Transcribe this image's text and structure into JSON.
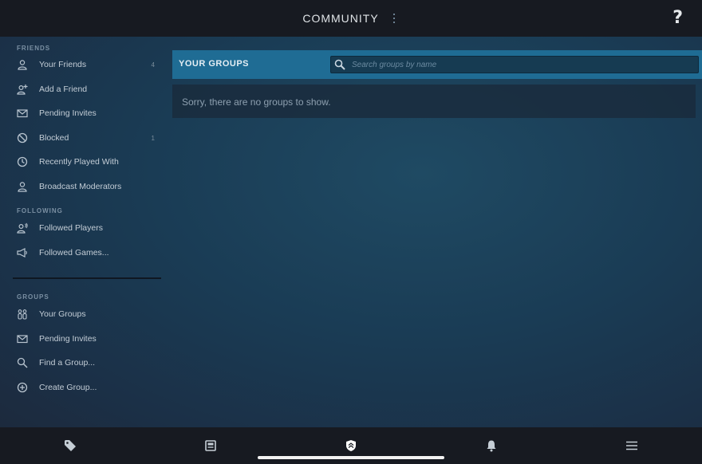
{
  "header": {
    "title": "COMMUNITY",
    "menu_icon": "kebab-icon",
    "help_label": "?"
  },
  "sidebar": {
    "friends_heading": "FRIENDS",
    "friends": [
      {
        "label": "Your Friends",
        "count": "4",
        "icon": "person-icon"
      },
      {
        "label": "Add a Friend",
        "count": "",
        "icon": "add-person-icon"
      },
      {
        "label": "Pending Invites",
        "count": "",
        "icon": "envelope-icon"
      },
      {
        "label": "Blocked",
        "count": "1",
        "icon": "blocked-icon"
      },
      {
        "label": "Recently Played With",
        "count": "",
        "icon": "clock-icon"
      },
      {
        "label": "Broadcast Moderators",
        "count": "",
        "icon": "person-icon"
      }
    ],
    "following_heading": "FOLLOWING",
    "following": [
      {
        "label": "Followed Players",
        "icon": "followed-person-icon"
      },
      {
        "label": "Followed Games...",
        "icon": "megaphone-icon"
      }
    ],
    "groups_heading": "GROUPS",
    "groups": [
      {
        "label": "Your Groups",
        "icon": "groups-icon"
      },
      {
        "label": "Pending Invites",
        "icon": "envelope-icon"
      },
      {
        "label": "Find a Group...",
        "icon": "search-icon"
      },
      {
        "label": "Create Group...",
        "icon": "plus-circle-icon"
      }
    ]
  },
  "main": {
    "section_title": "YOUR GROUPS",
    "search_placeholder": "Search groups by name",
    "search_value": "",
    "empty_message": "Sorry, there are no groups to show."
  },
  "tabbar": {
    "tabs": [
      {
        "name": "store",
        "icon": "tag-icon"
      },
      {
        "name": "library",
        "icon": "library-icon"
      },
      {
        "name": "community",
        "icon": "shield-icon"
      },
      {
        "name": "notifications",
        "icon": "bell-icon"
      },
      {
        "name": "menu",
        "icon": "hamburger-icon"
      }
    ]
  },
  "colors": {
    "background": "#1b2838",
    "header_bar": "#171a21",
    "accent_header": "#1f6c94",
    "text": "#c7d5e0"
  }
}
